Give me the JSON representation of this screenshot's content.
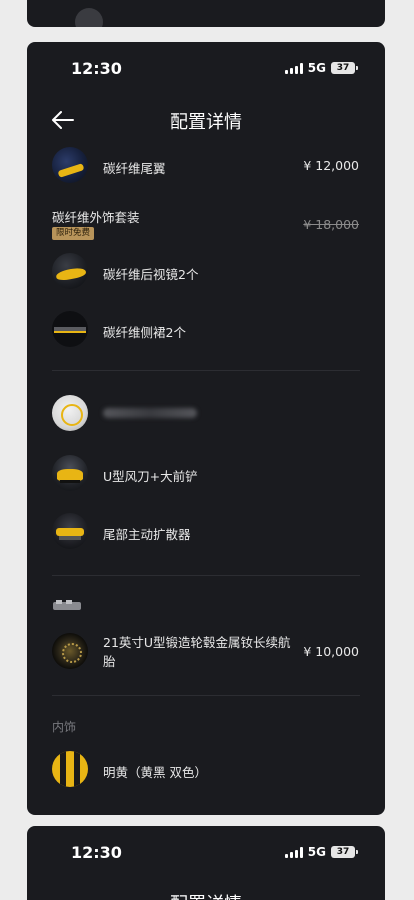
{
  "status": {
    "time": "12:30",
    "network": "5G",
    "battery": "37"
  },
  "header": {
    "title": "配置详情"
  },
  "items": [
    {
      "name": "碳纤维尾翼",
      "price": "¥ 12,000"
    },
    {
      "name": "碳纤维外饰套装",
      "price": "¥ 18,000",
      "badge": "限时免费"
    },
    {
      "name": "碳纤维后视镜2个"
    },
    {
      "name": "碳纤维侧裙2个"
    },
    {
      "name": ""
    },
    {
      "name": "U型风刀+大前铲"
    },
    {
      "name": "尾部主动扩散器"
    },
    {
      "name": "21英寸U型锻造轮毂金属钕长续航胎",
      "price": "¥ 10,000"
    },
    {
      "name": "明黄（黄黑 双色）"
    }
  ],
  "sections": {
    "interior": "内饰"
  },
  "bottom_card": {
    "title_fragment": "配置详情"
  },
  "colors": {
    "background": "#1a1b1f",
    "accent_yellow": "#e8b514",
    "badge": "#b8945a"
  }
}
